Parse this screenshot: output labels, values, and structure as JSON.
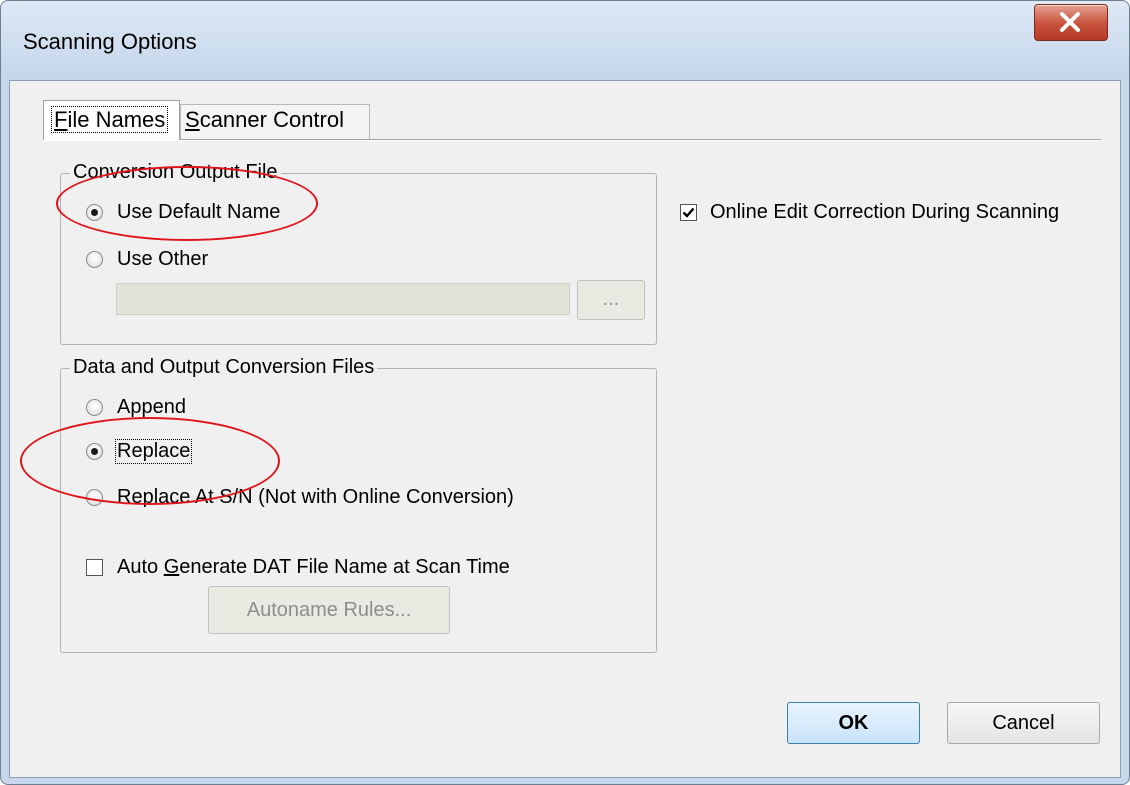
{
  "window": {
    "title": "Scanning Options"
  },
  "tabs": {
    "file_names_prefix": "F",
    "file_names_rest": "ile Names",
    "scanner_control_prefix": "S",
    "scanner_control_rest": "canner Control"
  },
  "conversion_output_file": {
    "legend": "Conversion Output File",
    "use_default_name": "Use Default Name",
    "use_other": "Use Other",
    "browse_label": "...",
    "selected": "Use Default Name"
  },
  "data_output_files": {
    "legend": "Data and Output Conversion Files",
    "append": "Append",
    "replace": "Replace",
    "replace_at_sn": "Replace At S/N (Not with Online Conversion)",
    "selected": "Replace",
    "auto_generate_prefix": "Auto ",
    "auto_generate_mnemonic": "G",
    "auto_generate_rest": "enerate DAT File Name at Scan Time",
    "auto_generate_checked": false,
    "autoname_rules": "Autoname Rules..."
  },
  "online_edit": {
    "label": "Online Edit Correction During Scanning",
    "checked": true
  },
  "buttons": {
    "ok": "OK",
    "cancel": "Cancel"
  },
  "colors": {
    "annotation": "#e0151b",
    "title_bar": "#c6d7ec",
    "close_button": "#c7513a"
  }
}
